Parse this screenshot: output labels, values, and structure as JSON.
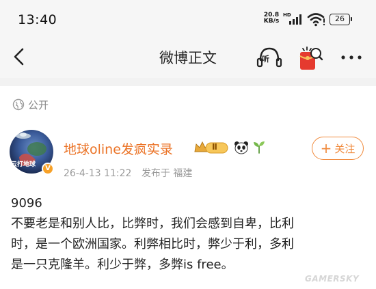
{
  "status_bar": {
    "time": "13:40",
    "net_speed_value": "20.8",
    "net_speed_unit": "KB/s",
    "hd_label": "HD",
    "battery": "26"
  },
  "nav": {
    "title": "微博正文",
    "listen_label": "听"
  },
  "privacy": {
    "label": "公开"
  },
  "author": {
    "name": "地球oline发疯实录",
    "avatar_text": "云打地球",
    "verified_mark": "V",
    "level_label": "Ⅱ",
    "timestamp": "26-4-13 11:22",
    "published_from": "发布于 福建"
  },
  "follow": {
    "plus": "+",
    "label": "关注"
  },
  "post": {
    "lines": [
      "9096",
      "不要老是和别人比，比弊时，我们会感到自卑，比利",
      "时，是一个欧洲国家。利弊相比时，弊少于利，多利",
      "是一只克隆羊。利少于弊，多弊is free。"
    ]
  },
  "watermark": "GAMERSKY",
  "colors": {
    "accent_orange": "#eb7326",
    "follow_orange": "#f08a3c",
    "meta_gray": "#9a9a9a",
    "bar_bg": "#f6f6f6"
  },
  "icons": [
    "back-icon",
    "listen-icon",
    "red-packet-icon",
    "more-icon",
    "globe-icon",
    "crown-icon",
    "panda-icon",
    "sprout-icon",
    "signal-icon",
    "wifi-icon"
  ]
}
